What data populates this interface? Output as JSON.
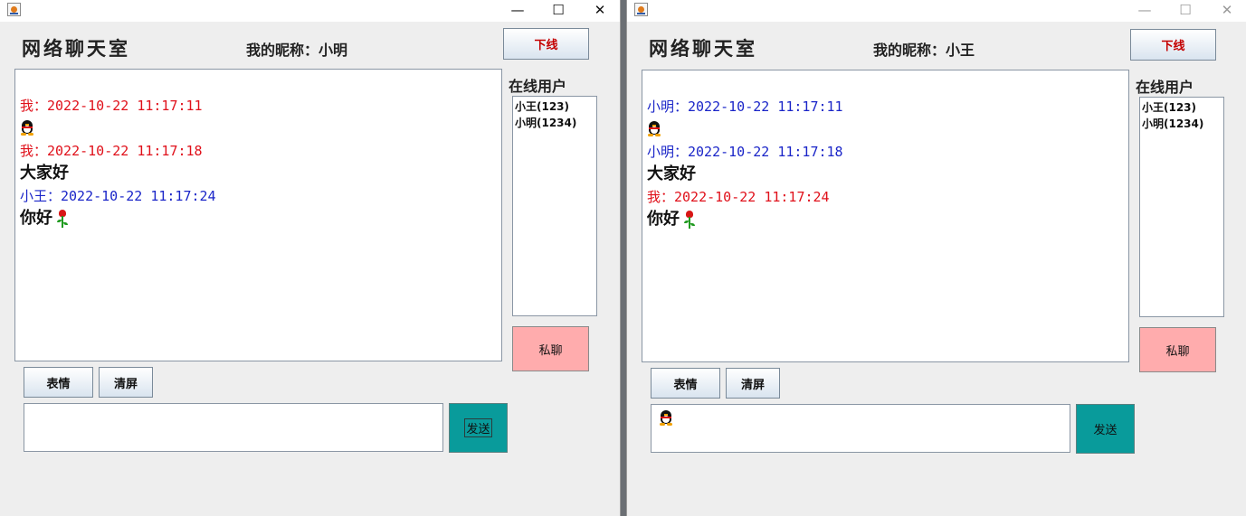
{
  "left_window": {
    "app_title": "网络聊天室",
    "nickname_label": "我的昵称：小明",
    "logout_label": "下线",
    "online_users_label": "在线用户",
    "users": [
      "小王(123)",
      "小明(1234)"
    ],
    "private_chat_label": "私聊",
    "emoji_label": "表情",
    "clear_label": "清屏",
    "send_label": "发送",
    "messages": [
      {
        "header": "我：2022-10-22 11:17:11",
        "color": "#e0101a",
        "text": "",
        "icon": "penguin"
      },
      {
        "header": "我：2022-10-22 11:17:18",
        "color": "#e0101a",
        "text": "大家好",
        "icon": ""
      },
      {
        "header": "小王：2022-10-22 11:17:24",
        "color": "#1a25c8",
        "text": "你好",
        "icon": "rose"
      }
    ]
  },
  "right_window": {
    "app_title": "网络聊天室",
    "nickname_label": "我的昵称：小王",
    "logout_label": "下线",
    "online_users_label": "在线用户",
    "users": [
      "小王(123)",
      "小明(1234)"
    ],
    "private_chat_label": "私聊",
    "emoji_label": "表情",
    "clear_label": "清屏",
    "send_label": "发送",
    "input_icon": "penguin",
    "messages": [
      {
        "header": "小明：2022-10-22 11:17:11",
        "color": "#1a25c8",
        "text": "",
        "icon": "penguin"
      },
      {
        "header": "小明：2022-10-22 11:17:18",
        "color": "#1a25c8",
        "text": "大家好",
        "icon": ""
      },
      {
        "header": "我：2022-10-22 11:17:24",
        "color": "#e0101a",
        "text": "你好",
        "icon": "rose"
      }
    ]
  },
  "window_controls": {
    "minimize": "—",
    "maximize": "☐",
    "close": "✕"
  },
  "colors": {
    "private_btn": "#ffacad",
    "send_btn": "#099b9b",
    "self_msg": "#e0101a",
    "other_msg": "#1a25c8"
  }
}
